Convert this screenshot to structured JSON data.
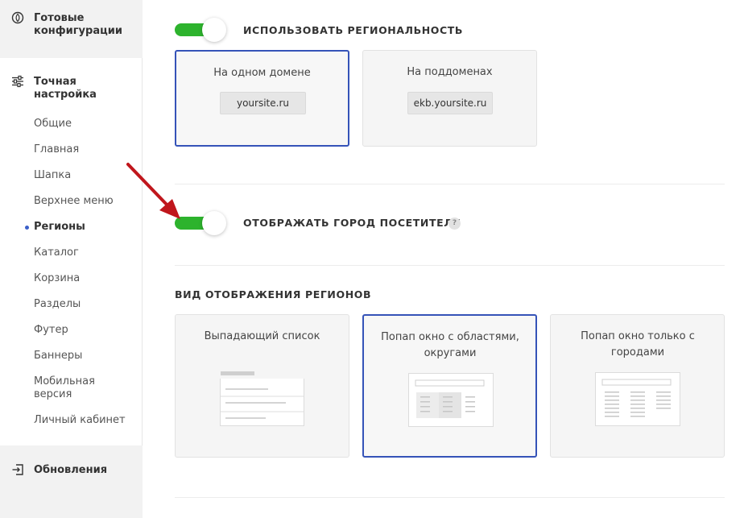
{
  "sidebar": {
    "ready_configs": "Готовые конфигурации",
    "fine_tuning": "Точная настройка",
    "items": [
      {
        "label": "Общие"
      },
      {
        "label": "Главная"
      },
      {
        "label": "Шапка"
      },
      {
        "label": "Верхнее меню"
      },
      {
        "label": "Регионы",
        "active": true
      },
      {
        "label": "Каталог"
      },
      {
        "label": "Корзина"
      },
      {
        "label": "Разделы"
      },
      {
        "label": "Футер"
      },
      {
        "label": "Баннеры"
      },
      {
        "label": "Мобильная версия"
      },
      {
        "label": "Личный кабинет"
      }
    ],
    "updates": "Обновления"
  },
  "regionality": {
    "title": "Использовать региональность",
    "enabled": true,
    "options": [
      {
        "label": "На одном домене",
        "example": "yoursite.ru",
        "selected": true
      },
      {
        "label": "На поддоменах",
        "example": "ekb.yoursite.ru",
        "selected": false
      }
    ]
  },
  "visitor_city": {
    "title": "Отображать город посетителя",
    "enabled": true,
    "help": "?"
  },
  "regions_view": {
    "title": "Вид отображения регионов",
    "options": [
      {
        "label": "Выпадающий список",
        "selected": false
      },
      {
        "label": "Попап окно с областями, округами",
        "selected": true
      },
      {
        "label": "Попап окно только с городами",
        "selected": false
      }
    ]
  },
  "colors": {
    "accent": "#3553b8",
    "toggle_on": "#2db32d",
    "arrow": "#c0161c"
  }
}
